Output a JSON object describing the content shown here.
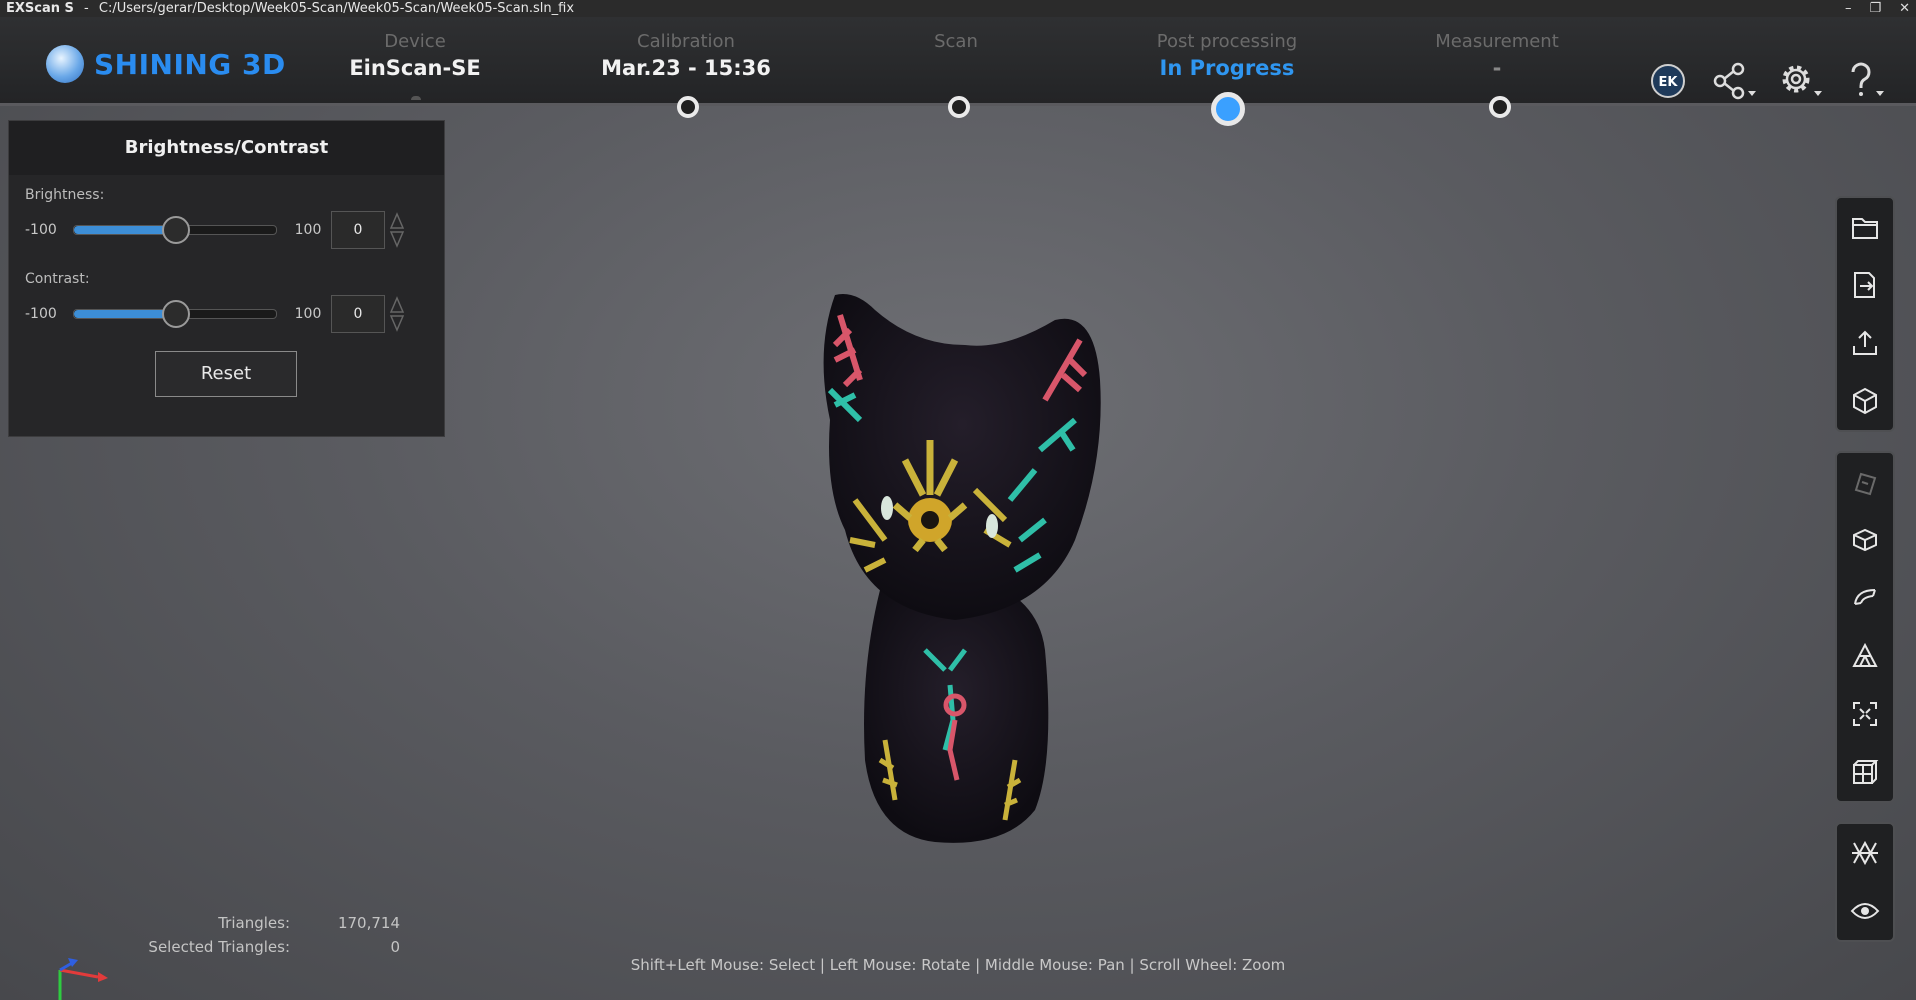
{
  "titlebar": {
    "app": "EXScan S",
    "separator": "-",
    "path": "C:/Users/gerar/Desktop/Week05-Scan/Week05-Scan/Week05-Scan.sln_fix"
  },
  "brand": {
    "name": "SHINING 3D",
    "color": "#2a8cf0"
  },
  "steps": [
    {
      "label": "Device",
      "value": "EinScan-SE"
    },
    {
      "label": "Calibration",
      "value": "Mar.23 - 15:36"
    },
    {
      "label": "Scan",
      "value": ""
    },
    {
      "label": "Post processing",
      "value": "In Progress"
    },
    {
      "label": "Measurement",
      "value": "-"
    }
  ],
  "header_icons": [
    "ek-model-icon",
    "share-icon",
    "settings-gear-icon",
    "help-icon"
  ],
  "panel": {
    "title": "Brightness/Contrast",
    "brightness": {
      "label": "Brightness:",
      "min": "-100",
      "max": "100",
      "value": "0",
      "level": 0
    },
    "contrast": {
      "label": "Contrast:",
      "min": "-100",
      "max": "100",
      "value": "0",
      "level": 0
    },
    "reset_label": "Reset"
  },
  "toolbar_icons": [
    [
      "open-folder-icon",
      "export-icon",
      "upload-icon",
      "cube-icon"
    ],
    [
      "hole-fill-icon",
      "cut-box-icon",
      "curve-icon",
      "mesh-triangle-icon",
      "fit-view-icon",
      "bounding-box-icon"
    ],
    [
      "align-icon",
      "view-eye-icon"
    ]
  ],
  "stats": {
    "triangles_label": "Triangles:",
    "triangles_value": "170,714",
    "selected_label": "Selected Triangles:",
    "selected_value": "0"
  },
  "hint": "Shift+Left Mouse: Select | Left Mouse: Rotate | Middle Mouse: Pan | Scroll Wheel: Zoom",
  "colors": {
    "accent": "#2f96f0",
    "panel": "#262628",
    "header": "#2f3032"
  }
}
